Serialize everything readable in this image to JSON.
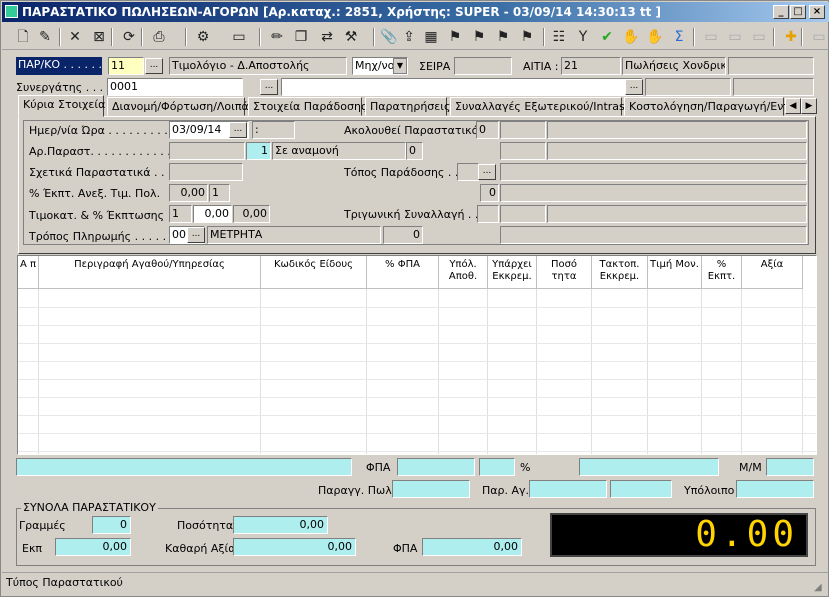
{
  "window": {
    "title": "ΠΑΡΑΣΤΑΤΙΚΟ ΠΩΛΗΣΕΩΝ-ΑΓΟΡΩΝ [Αρ.καταχ.: 2851, Χρήστης: SUPER - 03/09/14 14:30:13 tt ]",
    "min": "_",
    "max": "□",
    "close": "×"
  },
  "toolbar": {
    "icons": [
      "new-doc-icon",
      "edit-icon",
      "delete-icon",
      "cancel-icon",
      "refresh-icon",
      "print-icon",
      "wizard-icon",
      "folder-icon",
      "pencil-icon",
      "copy-icon",
      "transfer-icon",
      "settings-icon",
      "attach-icon",
      "export-icon",
      "calc-icon",
      "tool-a-icon",
      "tool-b-icon",
      "tool-c-icon",
      "tool-d-icon",
      "notes-icon",
      "filter-icon",
      "check-icon",
      "hand-icon",
      "hand2-icon",
      "sum-icon",
      "disabled-a-icon",
      "disabled-b-icon",
      "disabled-c-icon",
      "plus-icon",
      "disabled-d-icon"
    ]
  },
  "header": {
    "parko_label": "ΠΑΡ/ΚΟ . . . . . . .",
    "parko_value": "11",
    "parko_desc": "Τιμολόγιο - Δ.Αποστολής",
    "mode_value": "Μηχ/νο",
    "seira_label": "ΣΕΙΡΑ",
    "seira_value": "",
    "aitia_label": "ΑΙΤΙΑ :",
    "aitia_code": "21",
    "aitia_desc": "Πωλήσεις Χονδρικής",
    "synerg_label": "Συνεργάτης . . .",
    "synerg_value": "0001"
  },
  "tabs": [
    "Κύρια Στοιχεία",
    "Διανομή/Φόρτωση/Λοιπά",
    "Στοιχεία Παράδοσης",
    "Παρατηρήσεις",
    "Συναλλαγές Εξωτερικού/Intrastat",
    "Κοστολόγηση/Παραγωγή/Εντα"
  ],
  "main": {
    "date_label": "Ημερ/νία Ώρα . . . . . . . . .",
    "date_value": "03/09/14",
    "time_value": ":",
    "follow_label": "Ακολουθεί Παραστατικό .",
    "follow_value": "0",
    "arpar_label": "Αρ.Παραστ. . . . . . . . . . . . .",
    "arpar_value": "1",
    "status_value": "Σε αναμονή",
    "status_num": "0",
    "related_label": "Σχετικά Παραστατικά . . .",
    "topos_label": "Τόπος Παράδοσης . .",
    "disc_label": "% Έκπτ. Ανεξ. Τιμ. Πολ.",
    "disc_value": "0,00",
    "disc_value2": "1",
    "topos_num": "0",
    "timokat_label": "Τιμοκατ. & % Έκπτωσης",
    "timokat_value": "1",
    "timokat_pct": "0,00",
    "timokat_pct2": "0,00",
    "trig_label": "Τριγωνική Συναλλαγή . . .",
    "pay_label": "Τρόπος Πληρωμής . . . . . . .",
    "pay_code": "00",
    "pay_desc": "ΜΕΤΡΗΤΑ",
    "pay_num": "0"
  },
  "grid": {
    "columns": [
      "Α π",
      "Περιγραφή Αγαθού/Υπηρεσίας",
      "Κωδικός Είδους",
      "% ΦΠΑ",
      "Υπόλ. Αποθ.",
      "Υπάρχει Εκκρεμ.",
      "Ποσό τητα",
      "Τακτοπ. Εκκρεμ.",
      "Τιμή Μον.",
      "% Εκπτ.",
      "Αξία"
    ]
  },
  "bottom": {
    "fpa_label": "ΦΠΑ",
    "pct_label": "%",
    "mm_label": "Μ/Μ",
    "paragg_label": "Παραγγ. Πωλ.",
    "parag_label": "Παρ. Αγ.",
    "ypoloipo_label": "Υπόλοιπο"
  },
  "totals": {
    "group_label": "ΣΥΝΟΛΑ ΠΑΡΑΣΤΑΤΙΚΟΥ",
    "lines_label": "Γραμμές",
    "lines_value": "0",
    "qty_label": "Ποσότητα",
    "qty_value": "0,00",
    "ekp_label": "Εκπ",
    "ekp_value": "0,00",
    "net_label": "Καθαρή Αξία",
    "net_value": "0,00",
    "fpa_label": "ΦΠΑ",
    "fpa_value": "0,00",
    "display": "0.00"
  },
  "status_bar": {
    "text": "Τύπος Παραστατικού"
  }
}
